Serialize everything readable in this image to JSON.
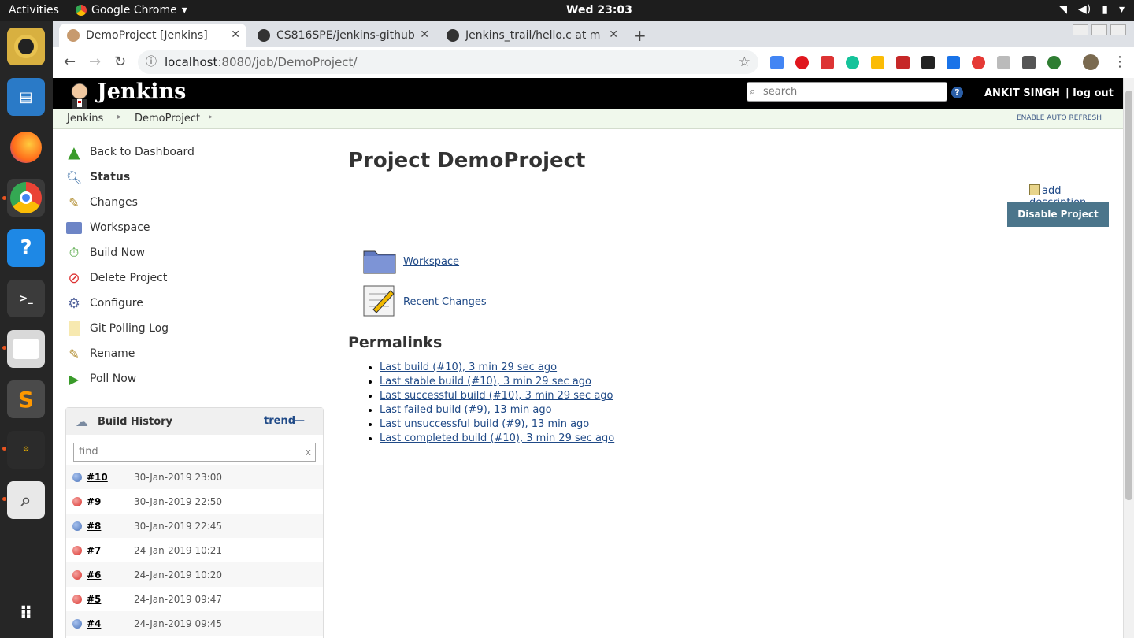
{
  "os": {
    "activities": "Activities",
    "app_name": "Google Chrome",
    "clock": "Wed 23:03"
  },
  "browser": {
    "tabs": [
      {
        "label": "DemoProject [Jenkins]",
        "active": true
      },
      {
        "label": "CS816SPE/jenkins-github",
        "active": false
      },
      {
        "label": "Jenkins_trail/hello.c at m",
        "active": false
      }
    ],
    "url_host": "localhost",
    "url_path": ":8080/job/DemoProject/"
  },
  "jenkins": {
    "logo_text": "Jenkins",
    "search_placeholder": "search",
    "help": "?",
    "user": "ANKIT SINGH",
    "logout": "| log out",
    "breadcrumbs": [
      "Jenkins",
      "DemoProject"
    ],
    "auto_refresh": "ENABLE AUTO REFRESH"
  },
  "sidepanel": {
    "tasks": [
      {
        "label": "Back to Dashboard",
        "icon": "up-arrow-icon"
      },
      {
        "label": "Status",
        "icon": "magnifier-icon"
      },
      {
        "label": "Changes",
        "icon": "notepad-icon"
      },
      {
        "label": "Workspace",
        "icon": "folder-icon"
      },
      {
        "label": "Build Now",
        "icon": "clock-play-icon"
      },
      {
        "label": "Delete Project",
        "icon": "no-entry-icon"
      },
      {
        "label": "Configure",
        "icon": "gear-icon"
      },
      {
        "label": "Git Polling Log",
        "icon": "clipboard-icon"
      },
      {
        "label": "Rename",
        "icon": "notepad-icon"
      },
      {
        "label": "Poll Now",
        "icon": "play-clipboard-icon"
      }
    ]
  },
  "build_history": {
    "title": "Build History",
    "trend": "trend",
    "minus": "—",
    "find_placeholder": "find",
    "clear": "x",
    "builds": [
      {
        "num": "#10",
        "date": "30-Jan-2019 23:00",
        "status": "blue"
      },
      {
        "num": "#9",
        "date": "30-Jan-2019 22:50",
        "status": "red"
      },
      {
        "num": "#8",
        "date": "30-Jan-2019 22:45",
        "status": "blue"
      },
      {
        "num": "#7",
        "date": "24-Jan-2019 10:21",
        "status": "red"
      },
      {
        "num": "#6",
        "date": "24-Jan-2019 10:20",
        "status": "red"
      },
      {
        "num": "#5",
        "date": "24-Jan-2019 09:47",
        "status": "red"
      },
      {
        "num": "#4",
        "date": "24-Jan-2019 09:45",
        "status": "blue"
      }
    ]
  },
  "main": {
    "title": "Project DemoProject",
    "add_description": "add description",
    "disable_button": "Disable Project",
    "workspace_link": "Workspace",
    "recent_changes_link": "Recent Changes",
    "permalinks_title": "Permalinks",
    "permalinks": [
      "Last build (#10), 3 min 29 sec ago",
      "Last stable build (#10), 3 min 29 sec ago",
      "Last successful build (#10), 3 min 29 sec ago",
      "Last failed build (#9), 13 min ago",
      "Last unsuccessful build (#9), 13 min ago",
      "Last completed build (#10), 3 min 29 sec ago"
    ]
  },
  "colors": {
    "blue_ball": "#4a72b8",
    "red_ball": "#d9312b",
    "button": "#4b758b"
  }
}
